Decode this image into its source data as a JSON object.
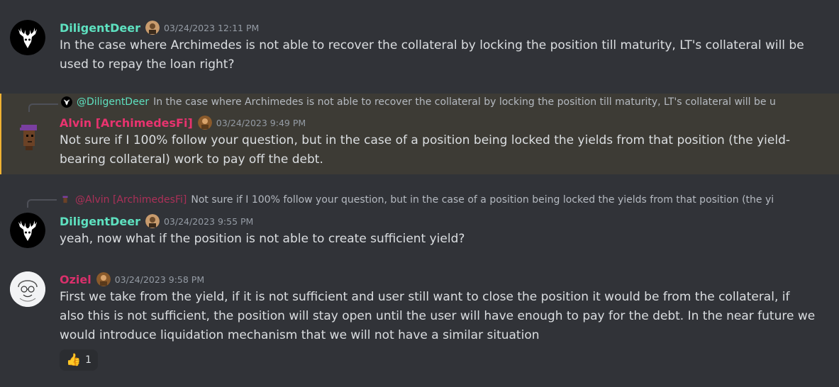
{
  "messages": [
    {
      "author": "DiligentDeer",
      "author_color": "#5ee1c0",
      "timestamp": "03/24/2023 12:11 PM",
      "text": "In the case where Archimedes is not able to recover the collateral by locking the position till maturity, LT's collateral will be used to repay the loan right?"
    },
    {
      "reply_to": {
        "name": "@DiligentDeer",
        "text": "In the case where Archimedes is not able to recover the collateral by locking the position till maturity, LT's collateral will be u"
      },
      "author": "Alvin [ArchimedesFi]",
      "author_color": "#e8336f",
      "timestamp": "03/24/2023 9:49 PM",
      "text": "Not sure if I 100% follow your question, but in the case of a position being locked the yields from that position (the yield-bearing collateral) work to pay off the debt.",
      "highlight_bg": "#3d3b35"
    },
    {
      "reply_to": {
        "name": "@Alvin [ArchimedesFi]",
        "text": "Not sure if I 100% follow your question, but in the case of a position being locked the yields from that position (the yi"
      },
      "author": "DiligentDeer",
      "author_color": "#5ee1c0",
      "timestamp": "03/24/2023 9:55 PM",
      "text": "yeah, now what if the position is not able to create sufficient yield?"
    },
    {
      "author": "Oziel",
      "author_color": "#d9306b",
      "timestamp": "03/24/2023 9:58 PM",
      "text": "First we take from the yield, if it is not sufficient and user still want to close the position it would be from the collateral, if also this is not sufficient, the position will stay open until the user will have enough to pay for the debt. In the near future we would introduce liquidation mechanism that we will not have a similar situation",
      "reaction": {
        "emoji": "👍",
        "count": "1"
      }
    }
  ]
}
